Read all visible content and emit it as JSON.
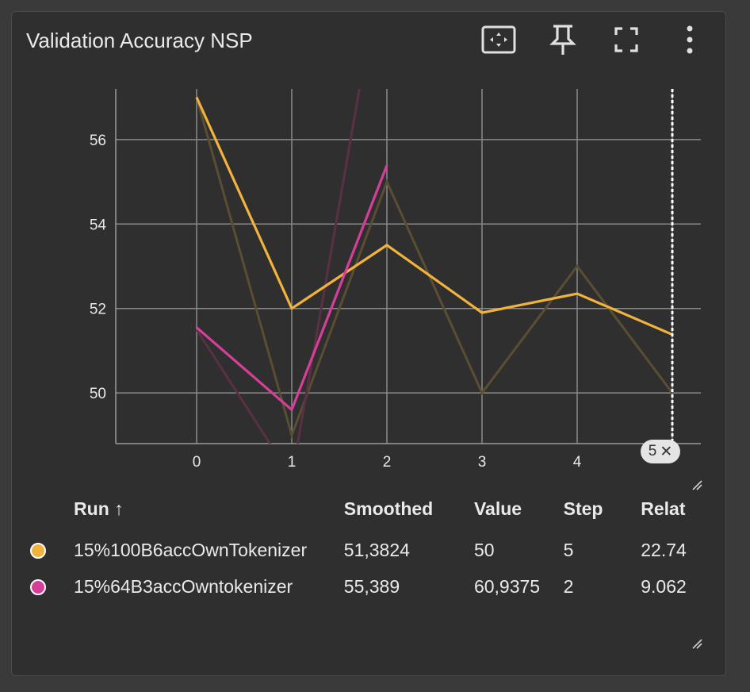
{
  "card": {
    "title": "Validation Accuracy NSP",
    "tools": [
      "fit-domain-icon",
      "pin-icon",
      "fullscreen-icon",
      "more-vert-icon"
    ]
  },
  "chart_data": {
    "type": "line",
    "x_ticks": [
      0,
      1,
      2,
      3,
      4,
      5
    ],
    "y_ticks": [
      50,
      52,
      54,
      56
    ],
    "xlim": [
      -0.85,
      5.3
    ],
    "ylim": [
      48.8,
      57.2
    ],
    "cursor_step": 5,
    "cursor_label": "5",
    "grid": true,
    "series": [
      {
        "name": "15%100B6accOwnTokenizer",
        "color": "#f2b33d",
        "raw_color": "#5a4e32",
        "x": [
          0,
          1,
          2,
          3,
          4,
          5
        ],
        "raw": [
          57,
          49,
          55,
          50,
          53,
          50
        ],
        "smoothed": [
          57,
          52,
          53.5,
          51.9,
          52.35,
          51.3824
        ]
      },
      {
        "name": "15%64B3accOwntokenizer",
        "color": "#d53f99",
        "raw_color": "#5a3044",
        "x": [
          0,
          1,
          2
        ],
        "raw": [
          51.5,
          48,
          60.9375
        ],
        "smoothed": [
          51.55,
          49.6,
          55.389
        ]
      }
    ]
  },
  "table": {
    "headers": {
      "run": "Run ↑",
      "smoothed": "Smoothed",
      "value": "Value",
      "step": "Step",
      "relative": "Relat"
    },
    "rows": [
      {
        "color": "#f2b33d",
        "run": "15%100B6accOwnTokenizer",
        "smoothed": "51,3824",
        "value": "50",
        "step": "5",
        "relative": "22.74"
      },
      {
        "color": "#d53f99",
        "run": "15%64B3accOwntokenizer",
        "smoothed": "55,389",
        "value": "60,9375",
        "step": "2",
        "relative": "9.062"
      }
    ]
  }
}
